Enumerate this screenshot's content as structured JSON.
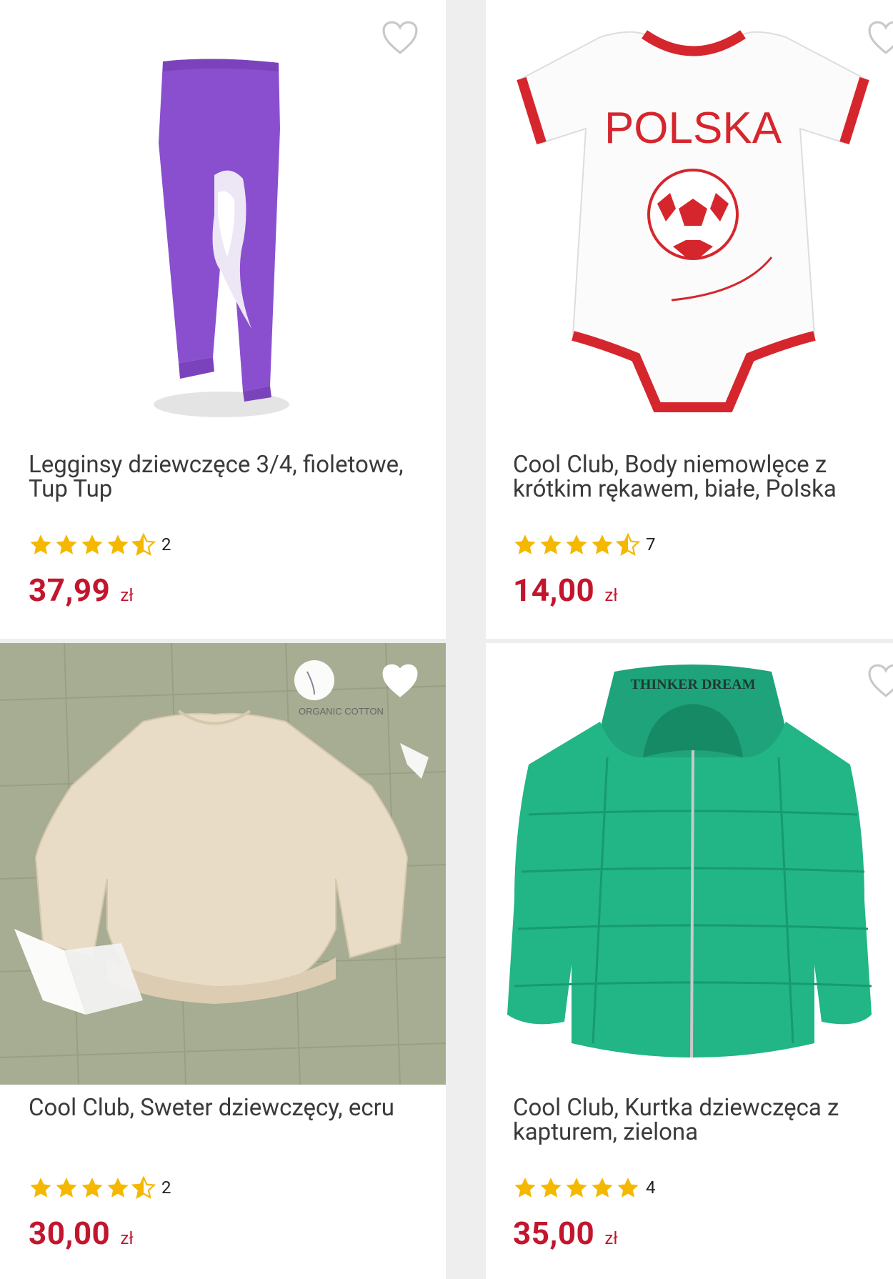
{
  "colors": {
    "price": "#c2162e",
    "star": "#f5b800",
    "background": "#eeeeee",
    "card": "#ffffff"
  },
  "products": [
    {
      "title": "Legginsy dziewczęce 3/4, fioletowe, Tup Tup",
      "rating_stars": 4.5,
      "rating_count": "2",
      "price_amount": "37,99",
      "currency": "zł",
      "image": "purple-leggings-image"
    },
    {
      "title": "Cool Club, Body niemowlęce z krótkim rękawem, białe, Polska",
      "rating_stars": 4.5,
      "rating_count": "7",
      "price_amount": "14,00",
      "currency": "zł",
      "image": "white-bodysuit-polska-image",
      "print_text": "POLSKA"
    },
    {
      "title": "Cool Club, Sweter dziewczęcy, ecru",
      "rating_stars": 4.5,
      "rating_count": "2",
      "price_amount": "30,00",
      "currency": "zł",
      "image": "ecru-sweater-image",
      "badge": "ORGANIC COTTON"
    },
    {
      "title": "Cool Club, Kurtka dziewczęca z kapturem, zielona",
      "rating_stars": 5,
      "rating_count": "4",
      "price_amount": "35,00",
      "currency": "zł",
      "image": "green-jacket-image",
      "hood_text": "THINKER DREAM"
    }
  ]
}
